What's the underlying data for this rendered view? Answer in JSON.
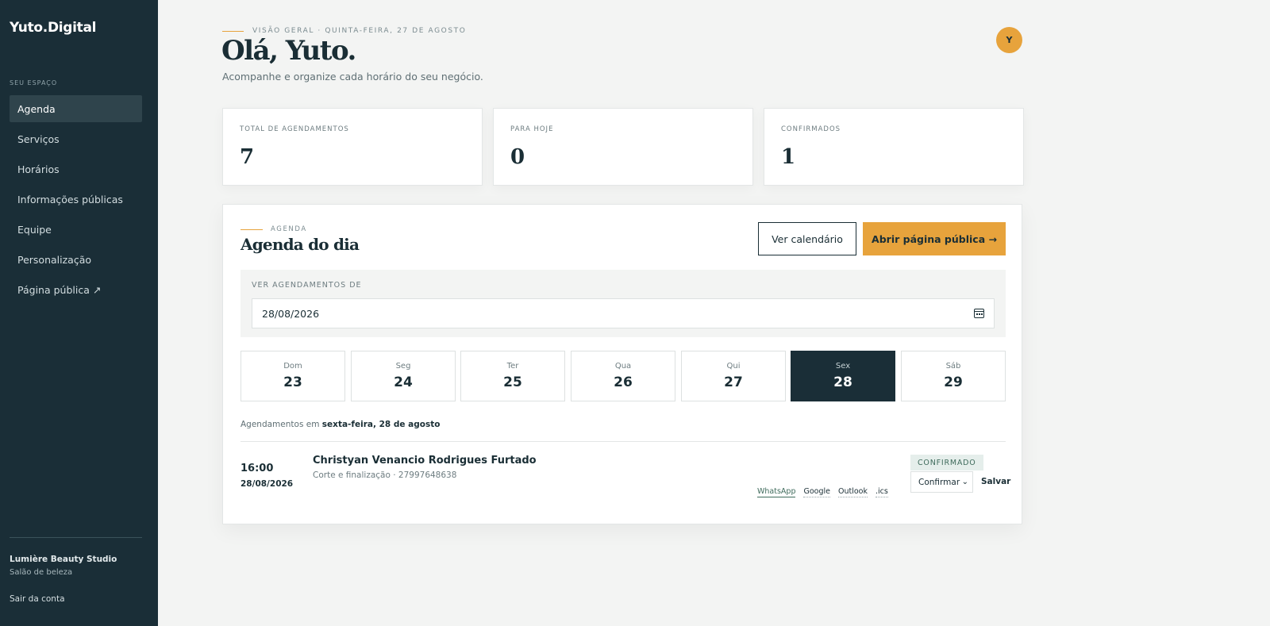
{
  "sidebar": {
    "brand": "Yuto.Digital",
    "section_label": "SEU ESPAÇO",
    "items": [
      {
        "label": "Agenda"
      },
      {
        "label": "Serviços"
      },
      {
        "label": "Horários"
      },
      {
        "label": "Informações públicas"
      },
      {
        "label": "Equipe"
      },
      {
        "label": "Personalização"
      },
      {
        "label": "Página pública ↗"
      }
    ],
    "studio_name": "Lumière Beauty Studio",
    "studio_type": "Salão de beleza",
    "logout": "Sair da conta"
  },
  "header": {
    "eyebrow": "VISÃO GERAL · QUINTA-FEIRA, 27 DE AGOSTO",
    "greeting": "Olá, Yuto.",
    "subtitle": "Acompanhe e organize cada horário do seu negócio.",
    "avatar_initial": "Y"
  },
  "stats": [
    {
      "label": "TOTAL DE AGENDAMENTOS",
      "value": "7"
    },
    {
      "label": "PARA HOJE",
      "value": "0"
    },
    {
      "label": "CONFIRMADOS",
      "value": "1"
    }
  ],
  "agenda": {
    "eyebrow": "AGENDA",
    "title": "Agenda do dia",
    "calendar_button": "Ver calendário",
    "public_button": "Abrir página pública →",
    "filter_label": "VER AGENDAMENTOS DE",
    "date_value": "28/08/2026",
    "days": [
      {
        "name": "Dom",
        "num": "23"
      },
      {
        "name": "Seg",
        "num": "24"
      },
      {
        "name": "Ter",
        "num": "25"
      },
      {
        "name": "Qua",
        "num": "26"
      },
      {
        "name": "Qui",
        "num": "27"
      },
      {
        "name": "Sex",
        "num": "28"
      },
      {
        "name": "Sáb",
        "num": "29"
      }
    ],
    "list_caption_prefix": "Agendamentos em",
    "list_caption_date": "sexta-feira, 28 de agosto",
    "appointment": {
      "time": "16:00",
      "date": "28/08/2026",
      "client": "Christyan Venancio Rodrigues Furtado",
      "detail": "Corte e finalização · 27997648638",
      "status": "CONFIRMADO",
      "links": [
        "WhatsApp",
        "Google",
        "Outlook",
        ".ics"
      ],
      "select_value": "Confirmar",
      "save": "Salvar"
    }
  },
  "colors": {
    "sidebar_bg": "#1a2e37",
    "accent": "#e7a33c",
    "text_dark": "#1a2e35",
    "page_bg": "#f3f4f3"
  }
}
